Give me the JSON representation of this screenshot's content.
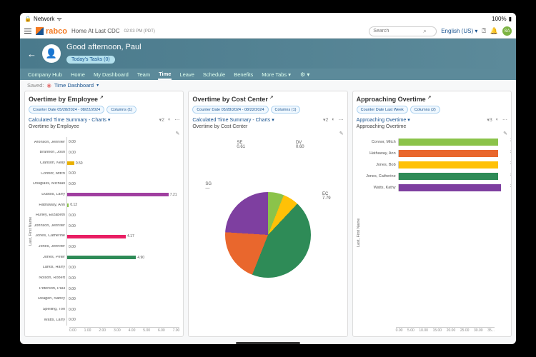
{
  "status": {
    "network": "Network",
    "battery": "100%"
  },
  "topbar": {
    "brand": "rabco",
    "crumb": "Home At Last CDC",
    "time": "02:03 PM (PDT)",
    "search_ph": "Search",
    "lang": "English (US)",
    "avatar": "SA"
  },
  "hero": {
    "greeting": "Good afternoon, Paul",
    "tasks": "Today's Tasks (0)"
  },
  "tabs": [
    "Company Hub",
    "Home",
    "My Dashboard",
    "Team",
    "Time",
    "Leave",
    "Schedule",
    "Benefits",
    "More Tabs"
  ],
  "active_tab": 4,
  "saved": {
    "label": "Saved:",
    "link": "Time Dashboard"
  },
  "card1": {
    "title": "Overtime by Employee",
    "chip1": "Counter Date\n05/28/2024 - 08/22/2024",
    "chip2": "Columns (1)",
    "subtitle": "Calculated Time Summary - Charts",
    "chart_title": "Overtime by Employee",
    "ylabel": "Last, First Name"
  },
  "card2": {
    "title": "Overtime by Cost Center",
    "chip1": "Counter Date\n05/28/2024 - 08/22/2024",
    "chip2": "Columns (1)",
    "subtitle": "Calculated Time Summary - Charts",
    "chart_title": "Overtime by Cost Center"
  },
  "card3": {
    "title": "Approaching Overtime",
    "chip1": "Counter Date\nLast Week",
    "chip2": "Columns (2)",
    "subtitle": "Approaching Overtime",
    "chart_title": "Approaching Overtime",
    "ylabel": "Last, First Name"
  },
  "chart_data": [
    {
      "type": "bar",
      "title": "Overtime by Employee",
      "orientation": "horizontal",
      "xlabel": "",
      "ylabel": "Last, First Name",
      "xlim": [
        0,
        8
      ],
      "xticks": [
        "0.00",
        "1.00",
        "2.00",
        "3.00",
        "4.00",
        "5.00",
        "6.00",
        "7.00"
      ],
      "categories": [
        "Aronson, Jennifer",
        "Brannon, Josh",
        "Clarison, Kelly",
        "Connor, Mitch",
        "Douglass, Michael",
        "Dubois, Larry",
        "Hathaway, Ann",
        "Hurley, Elizabeth",
        "Johnson, Jennifer",
        "Jones, Catherine",
        "Jones, Jennifer",
        "Jones, Peter",
        "Larkis, Harry",
        "Nolson, Robert",
        "Peterson, Paul",
        "Reagen, Nancy",
        "Spelling, Tori",
        "Watts, Larry"
      ],
      "values": [
        0.0,
        0.0,
        0.5,
        0.0,
        0.0,
        7.21,
        0.12,
        0.0,
        0.0,
        4.17,
        0.0,
        4.9,
        0.0,
        0.0,
        0.0,
        0.0,
        0.0,
        0.0
      ],
      "colors": [
        "",
        "",
        "#e9b000",
        "",
        "",
        "#a03fa0",
        "#8bc34a",
        "",
        "",
        "#e91e63",
        "",
        "#2e8b57",
        "",
        "",
        "",
        "",
        "",
        ""
      ]
    },
    {
      "type": "pie",
      "title": "Overtime by Cost Center",
      "series": [
        {
          "name": "SE",
          "value": 0.61,
          "color": "#8bc34a"
        },
        {
          "name": "DV",
          "value": 0.6,
          "color": "#ffc107"
        },
        {
          "name": "EC",
          "value": 7.79,
          "color": "#2e8b57"
        },
        {
          "name": "(orange)",
          "value": 3.5,
          "color": "#e9672d"
        },
        {
          "name": "SG",
          "value": 4.4,
          "color": "#7e3fa0"
        }
      ]
    },
    {
      "type": "bar",
      "title": "Approaching Overtime",
      "orientation": "horizontal",
      "xlabel": "",
      "ylabel": "Last, First Name",
      "xlim": [
        0,
        35
      ],
      "xticks": [
        "0.00",
        "5.00",
        "10.00",
        "15.00",
        "20.00",
        "25.00",
        "30.00",
        "35..."
      ],
      "categories": [
        "Connor, Mitch",
        "Hathaway, Ann",
        "Jones, Bob",
        "Jones, Catherine",
        "Watts, Kathy"
      ],
      "values": [
        32.0,
        32.0,
        32.0,
        32.0,
        32.99
      ],
      "colors": [
        "#8bc34a",
        "#e9672d",
        "#ffc107",
        "#2e8b57",
        "#7e3fa0"
      ]
    }
  ]
}
